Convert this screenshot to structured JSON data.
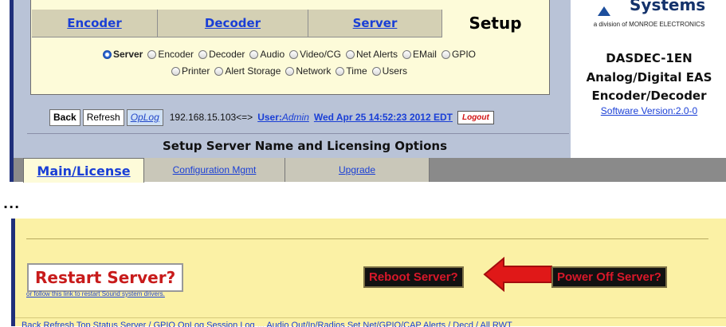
{
  "tabs": [
    {
      "label": "Encoder",
      "active": false
    },
    {
      "label": "Decoder",
      "active": false
    },
    {
      "label": "Server",
      "active": false
    },
    {
      "label": "Setup",
      "active": true
    }
  ],
  "setup_options_row1": [
    {
      "label": "Server",
      "selected": true
    },
    {
      "label": "Encoder",
      "selected": false
    },
    {
      "label": "Decoder",
      "selected": false
    },
    {
      "label": "Audio",
      "selected": false
    },
    {
      "label": "Video/CG",
      "selected": false
    },
    {
      "label": "Net Alerts",
      "selected": false
    },
    {
      "label": "EMail",
      "selected": false
    },
    {
      "label": "GPIO",
      "selected": false
    }
  ],
  "setup_options_row2": [
    {
      "label": "Printer",
      "selected": false
    },
    {
      "label": "Alert Storage",
      "selected": false
    },
    {
      "label": "Network",
      "selected": false
    },
    {
      "label": "Time",
      "selected": false
    },
    {
      "label": "Users",
      "selected": false
    }
  ],
  "toolbar": {
    "back": "Back",
    "refresh": "Refresh",
    "oplog": "OpLog",
    "ip": "192.168.15.103<=>",
    "user_prefix": "User:",
    "user_name": "Admin",
    "datetime": "Wed Apr 25 14:52:23 2012 EDT",
    "logout": "Logout"
  },
  "page_title": "Setup Server Name and Licensing Options",
  "subtabs": [
    {
      "label": "Main/License",
      "active": true
    },
    {
      "label": "Configuration Mgmt",
      "active": false
    },
    {
      "label": "Upgrade",
      "active": false
    }
  ],
  "brand": {
    "logo_text": "Systems",
    "division": "a division of MONROE ELECTRONICS",
    "product_line1": "DASDEC-1EN",
    "product_line2": "Analog/Digital EAS",
    "product_line3": "Encoder/Decoder",
    "software_version": "Software Version:2.0-0"
  },
  "ellipsis": "...",
  "actions": {
    "restart": "Restart Server?",
    "restart_link": "or follow this link to restart Sound system drivers.",
    "reboot": "Reboot Server?",
    "power_off": "Power Off Server?"
  },
  "footer_links": "Back  Refresh  Top  Status  Server / GPIO  OpLog  Session Log  ...  Audio Out/In/Radios  Set Net/GPIO/CAP  Alerts / Decd / All  RWT"
}
